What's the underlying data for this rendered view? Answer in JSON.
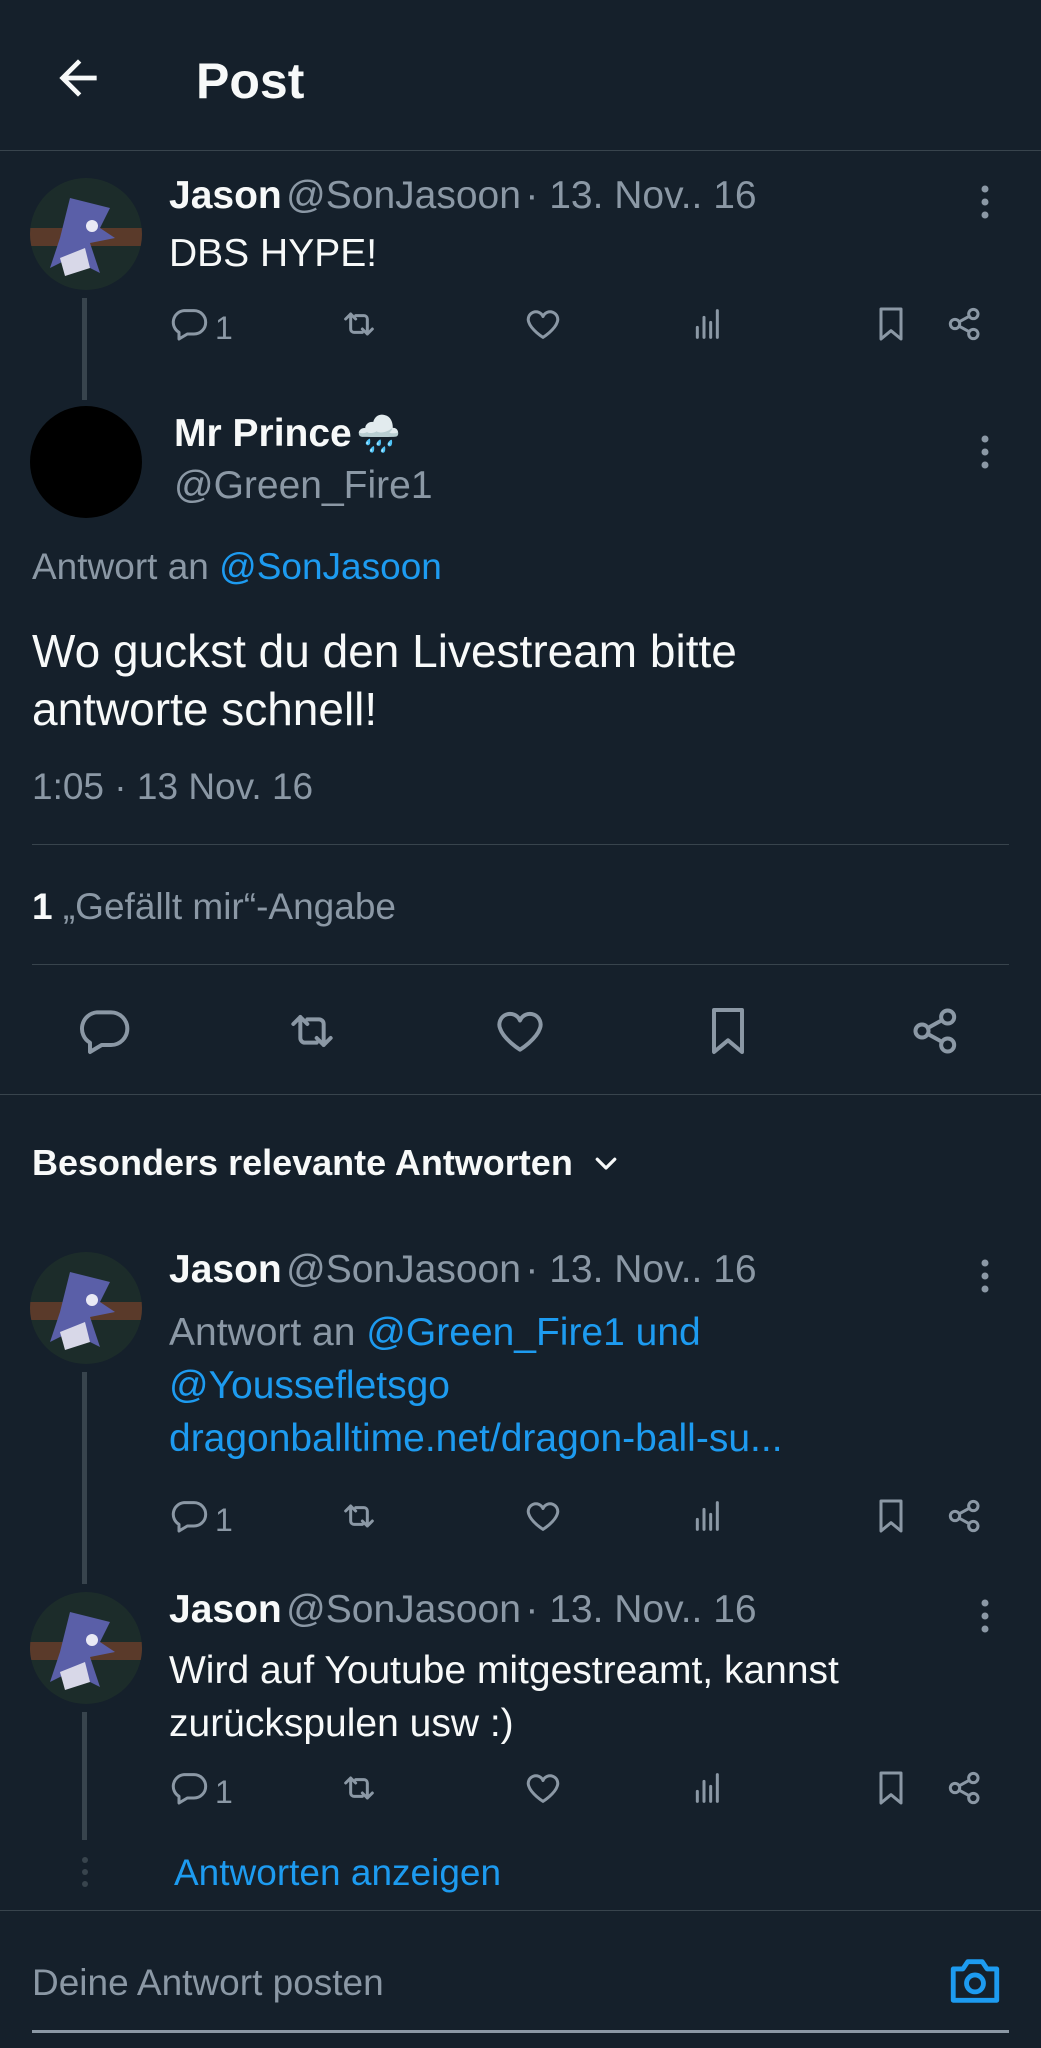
{
  "header": {
    "title": "Post"
  },
  "thread_parent": {
    "name": "Jason",
    "handle": "@SonJasoon",
    "date": "· 13. Nov.. 16",
    "text": "DBS HYPE!",
    "reply_count": "1"
  },
  "main_post": {
    "name": "Mr Prince",
    "emoji": "🌧️",
    "handle": "@Green_Fire1",
    "reply_prefix": "Antwort an",
    "reply_to": "@SonJasoon",
    "text_line1": "Wo guckst du den Livestream bitte",
    "text_line2": "antworte schnell!",
    "timestamp": "1:05 · 13 Nov. 16",
    "likes_count": "1",
    "likes_label": "„Gefällt mir“-Angabe"
  },
  "replies_section": {
    "label": "Besonders relevante Antworten"
  },
  "reply1": {
    "name": "Jason",
    "handle": "@SonJasoon",
    "date": "· 13. Nov.. 16",
    "reply_prefix": "Antwort an",
    "reply_to_line1": "@Green_Fire1 und",
    "reply_to_line2": "@Youssefletsgo",
    "link": "dragonballtime.net/dragon-ball-su...",
    "reply_count": "1"
  },
  "reply2": {
    "name": "Jason",
    "handle": "@SonJasoon",
    "date": "· 13. Nov.. 16",
    "text_line1": "Wird auf Youtube mitgestreamt, kannst",
    "text_line2": "zurückspulen usw :)",
    "reply_count": "1"
  },
  "show_replies": "Antworten anzeigen",
  "composer": {
    "placeholder": "Deine Antwort posten"
  },
  "colors": {
    "background": "#15202b",
    "accent": "#1d9bf0",
    "muted": "#8b98a5",
    "divider": "#38444d"
  },
  "icons": [
    "back-arrow-icon",
    "more-icon",
    "reply-icon",
    "retweet-icon",
    "like-icon",
    "views-icon",
    "bookmark-icon",
    "share-icon",
    "chevron-down-icon",
    "camera-icon"
  ]
}
